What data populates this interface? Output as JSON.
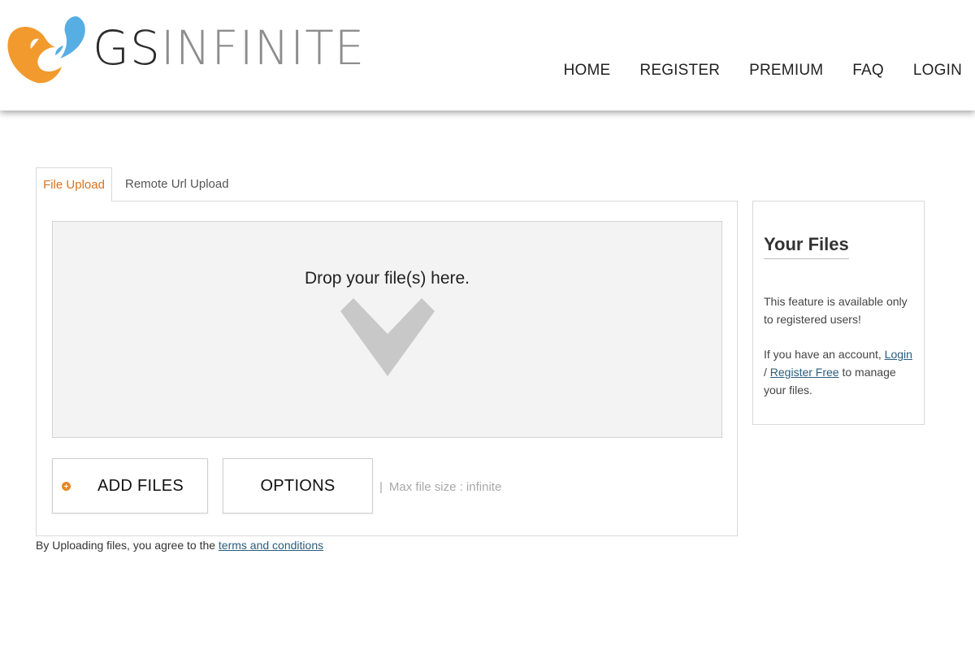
{
  "header": {
    "logo": {
      "text_gs": "GS",
      "text_rest": "INFINITE"
    },
    "nav": [
      {
        "label": "HOME"
      },
      {
        "label": "REGISTER"
      },
      {
        "label": "PREMIUM"
      },
      {
        "label": "FAQ"
      },
      {
        "label": "LOGIN"
      }
    ]
  },
  "tabs": [
    {
      "label": "File Upload",
      "active": true
    },
    {
      "label": "Remote Url Upload",
      "active": false
    }
  ],
  "upload": {
    "drop_text": "Drop your file(s) here.",
    "drop_icon": "chevron-down-icon",
    "add_files_label": "ADD FILES",
    "add_icon": "plus-circle-icon",
    "options_label": "OPTIONS",
    "max_size_separator": "|",
    "max_size_text": "Max file size : infinite"
  },
  "terms": {
    "prefix": "By Uploading files, you agree to the ",
    "link_label": "terms and conditions"
  },
  "side": {
    "title": "Your Files",
    "p1": "This feature is available only to registered users!",
    "p2_prefix": "If you have an account, ",
    "login_link": "Login",
    "p2_sep": " / ",
    "register_link": "Register Free",
    "p2_suffix": " to manage your files."
  },
  "colors": {
    "accent_orange": "#d9731f",
    "logo_blue": "#57aee3",
    "logo_orange": "#f29a2e",
    "link": "#2a5d7d"
  }
}
